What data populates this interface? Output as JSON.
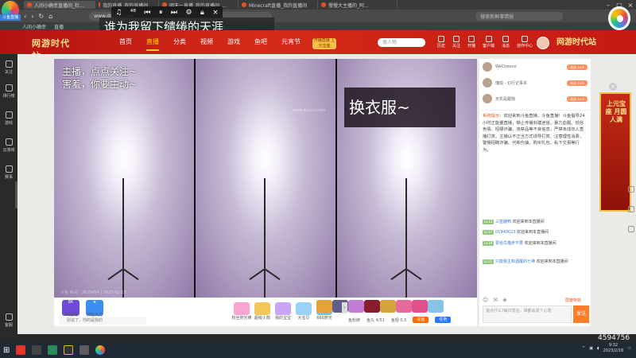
{
  "browser": {
    "tabs": [
      {
        "label": "人间小确幸直播间_杜..."
      },
      {
        "label": "我的直播_我的直播间_..."
      },
      {
        "label": "明天一直播_我的直播间_..."
      },
      {
        "label": "Minecraft直播_我的直播间"
      },
      {
        "label": "慢慢大主播的_阿..."
      }
    ],
    "address": "www.douyu.com",
    "search_placeholder": "搜索新鲜事情报"
  },
  "bookmarks": [
    "人间小确幸",
    "直播"
  ],
  "app_logo_label": "斗鱼直播",
  "music": {
    "lyric": "谁为我留下缱绻的天涯"
  },
  "site": {
    "logo": "网游时代站",
    "nav": [
      {
        "label": "首页",
        "active": false
      },
      {
        "label": "直播",
        "active": true
      },
      {
        "label": "分类",
        "active": false
      },
      {
        "label": "视频",
        "active": false
      },
      {
        "label": "游戏",
        "active": false
      },
      {
        "label": "鱼吧",
        "active": false
      },
      {
        "label": "元宵节",
        "active": false
      }
    ],
    "promo_badge": "开播直播 上元宝座",
    "search_placeholder": "搜人物",
    "header_icons": [
      "历史",
      "关注",
      "开播",
      "客户端",
      "消息",
      "创作中心"
    ],
    "header_promo": "网游时代站"
  },
  "siderail": [
    "关注",
    "排行榜",
    "游戏",
    "云游戏",
    "赛事",
    "客服"
  ],
  "player": {
    "overlay_text": [
      "主播，点点关注~",
      "害羞，你要主动~"
    ],
    "change_clothes": "换衣服~",
    "watermark": "www.douyu.com",
    "room_info": "斗鱼 房间：2628454 | 2023-02-16"
  },
  "giftbar": {
    "left_items": [
      {
        "badge": "8K",
        "label": "3K活动"
      },
      {
        "badge": "★",
        "label": "开始大力"
      }
    ],
    "gifts": [
      {
        "label": "粉丝荧光棒",
        "color": "#f8a6d0"
      },
      {
        "label": "超级火箭",
        "color": "#f3c65a"
      },
      {
        "label": "我的宝宝",
        "color": "#cba5f5"
      },
      {
        "label": "大宝贝",
        "color": "#9ad2f7"
      },
      {
        "label": "666荧光",
        "color": "#7fb8f7"
      },
      {
        "label": "",
        "color": "#e5a13a"
      },
      {
        "label": "",
        "color": "#5e5e8a"
      },
      {
        "label": "",
        "color": "#c27cd8"
      },
      {
        "label": "",
        "color": "#8a1a2e"
      },
      {
        "label": "",
        "color": "#d4a53d"
      },
      {
        "label": "",
        "color": "#e66a9b"
      },
      {
        "label": "",
        "color": "#e14f8d"
      },
      {
        "label": "",
        "color": "#86c5e8"
      }
    ],
    "input_preview": "别说了，你的是我的",
    "fans_label": "鱼粉牌",
    "fish_balls": "鱼丸 4/51",
    "yuchi": "鱼翅 0.5",
    "charge_label": "充值",
    "task_label": "任务"
  },
  "chat": {
    "rank": [
      {
        "name": "WeCheeno",
        "level": "粉丝 Lv.8"
      },
      {
        "name": "瑰瑜 - 幻行记事本",
        "level": "粉丝 Lv.6"
      },
      {
        "name": "天凯是跟狗",
        "level": "粉丝 Lv.5"
      }
    ],
    "system_tag": "系统提示：",
    "system_message": "欢迎来到斗鱼直播，斗鱼直播！斗鱼倡导24小时正能量直播，禁止传播封建迷信、暴力血腥、低俗色情、招嫖诈骗、违禁品等不良信息，严禁未成年人直播打赏。主播以不正当方式诱导打赏、注意理性消费，警惕招聘诈骗、代练代抽、购买礼包、私下交易等行为。",
    "lines": [
      {
        "level": "Lv.13",
        "name": "三蓝鹿鸭",
        "text": "欢迎来到本直播间"
      },
      {
        "level": "Lv.17",
        "name": "01940023",
        "text": "欢迎来到本直播间"
      },
      {
        "level": "Lv.19",
        "name": "爱给鸟猫步不要",
        "text": "欢迎来到本直播间"
      },
      {
        "level": "Lv.21",
        "name": "只能我主和酒醒的七神",
        "text": "欢迎来到本直播间"
      }
    ],
    "report_label": "屏蔽特效",
    "input_placeholder": "说点什么?每日发言，谁都会发个心意",
    "send_label": "发送"
  },
  "ad": {
    "close": "×",
    "banner": "上元宝座 月圆人满"
  },
  "tray": {
    "time": "9:32",
    "date": "2023/2/16"
  },
  "corner_number": "4594756"
}
